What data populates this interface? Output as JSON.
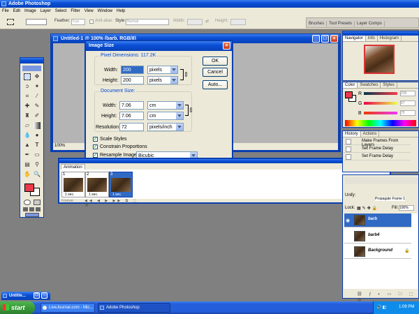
{
  "app": {
    "title": "Adobe Photoshop",
    "menu": [
      "File",
      "Edit",
      "Image",
      "Layer",
      "Select",
      "Filter",
      "View",
      "Window",
      "Help"
    ]
  },
  "options_bar": {
    "feather_label": "Feather:",
    "feather_value": "0 px",
    "antialias_label": "Anti-alias",
    "style_label": "Style:",
    "style_value": "Normal",
    "width_label": "Width:",
    "height_label": "Height:",
    "palette_tabs": [
      "Brushes",
      "Tool Presets",
      "Layer Comps"
    ]
  },
  "document": {
    "title": "Untitled-1 @ 100% (barb, RGB/8)",
    "zoom": "100%"
  },
  "image_size_dialog": {
    "title": "Image Size",
    "pixel_dimensions_label": "Pixel Dimensions:",
    "pixel_dimensions_value": "117.2K",
    "width_label": "Width:",
    "width_value": "200",
    "width_unit": "pixels",
    "height_label": "Height:",
    "height_value": "200",
    "height_unit": "pixels",
    "document_size_label": "Document Size:",
    "doc_width_label": "Width:",
    "doc_width_value": "7.06",
    "doc_width_unit": "cm",
    "doc_height_label": "Height:",
    "doc_height_value": "7.06",
    "doc_height_unit": "cm",
    "resolution_label": "Resolution:",
    "resolution_value": "72",
    "resolution_unit": "pixels/inch",
    "scale_styles_label": "Scale Styles",
    "constrain_label": "Constrain Proportions",
    "resample_label": "Resample Image:",
    "resample_value": "Bicubic",
    "ok_label": "OK",
    "cancel_label": "Cancel",
    "auto_label": "Auto..."
  },
  "animation": {
    "title": "Animation",
    "frames": [
      {
        "num": "1",
        "delay": "1 sec."
      },
      {
        "num": "2",
        "delay": "1 sec."
      },
      {
        "num": "3",
        "delay": "1 sec."
      }
    ],
    "loop": "Forever"
  },
  "navigator": {
    "tabs": [
      "Navigator",
      "Info",
      "Histogram"
    ]
  },
  "color_panel": {
    "tabs": [
      "Color",
      "Swatches",
      "Styles"
    ],
    "channels": [
      {
        "label": "R",
        "value": "236"
      },
      {
        "label": "G",
        "value": "57"
      },
      {
        "label": "B",
        "value": "75"
      }
    ],
    "foreground": "#ec394b",
    "background": "#ffffff"
  },
  "history": {
    "tabs": [
      "History",
      "Actions"
    ],
    "items": [
      "Make Frames From Layers",
      "Set Frame Delay",
      "Set Frame Delay"
    ]
  },
  "layers": {
    "unify_label": "Unify:",
    "propagate_label": "Propagate Frame 1",
    "lock_label": "Lock:",
    "fill_label": "Fill:",
    "fill_value": "100%",
    "items": [
      {
        "name": "barb",
        "selected": true
      },
      {
        "name": "barb4",
        "selected": false
      },
      {
        "name": "Background",
        "selected": false
      }
    ]
  },
  "minimized": {
    "title": "Untitle..."
  },
  "taskbar": {
    "start_label": "start",
    "tasks": [
      "LiveJournal.com - Mic...",
      "Adobe Photoshop"
    ],
    "clock": "1:09 PM"
  }
}
